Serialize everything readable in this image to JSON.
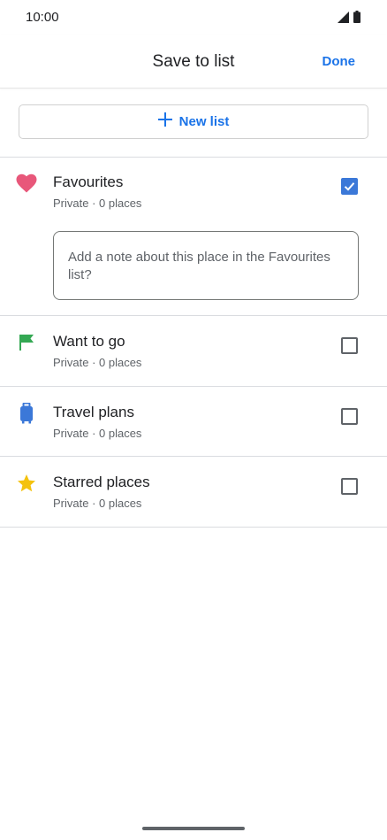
{
  "status_bar": {
    "time": "10:00",
    "icons": [
      "signal-icon",
      "battery-icon"
    ]
  },
  "header": {
    "title": "Save to list",
    "done_label": "Done"
  },
  "new_list": {
    "icon": "plus-icon",
    "label": "New list"
  },
  "lists": [
    {
      "name": "Favourites",
      "meta": "Private · 0 places",
      "icon": "heart-icon",
      "icon_color": "#e8577a",
      "checked": true
    },
    {
      "name": "Want to go",
      "meta": "Private · 0 places",
      "icon": "flag-icon",
      "icon_color": "#34a853",
      "checked": false
    },
    {
      "name": "Travel plans",
      "meta": "Private · 0 places",
      "icon": "suitcase-icon",
      "icon_color": "#3b78d8",
      "checked": false
    },
    {
      "name": "Starred places",
      "meta": "Private · 0 places",
      "icon": "star-icon",
      "icon_color": "#f4c20d",
      "checked": false
    }
  ],
  "note": {
    "placeholder": "Add a note about this place in the Favourites list?"
  },
  "colors": {
    "accent": "#1a73e8",
    "checkbox_checked": "#3b78d8"
  }
}
